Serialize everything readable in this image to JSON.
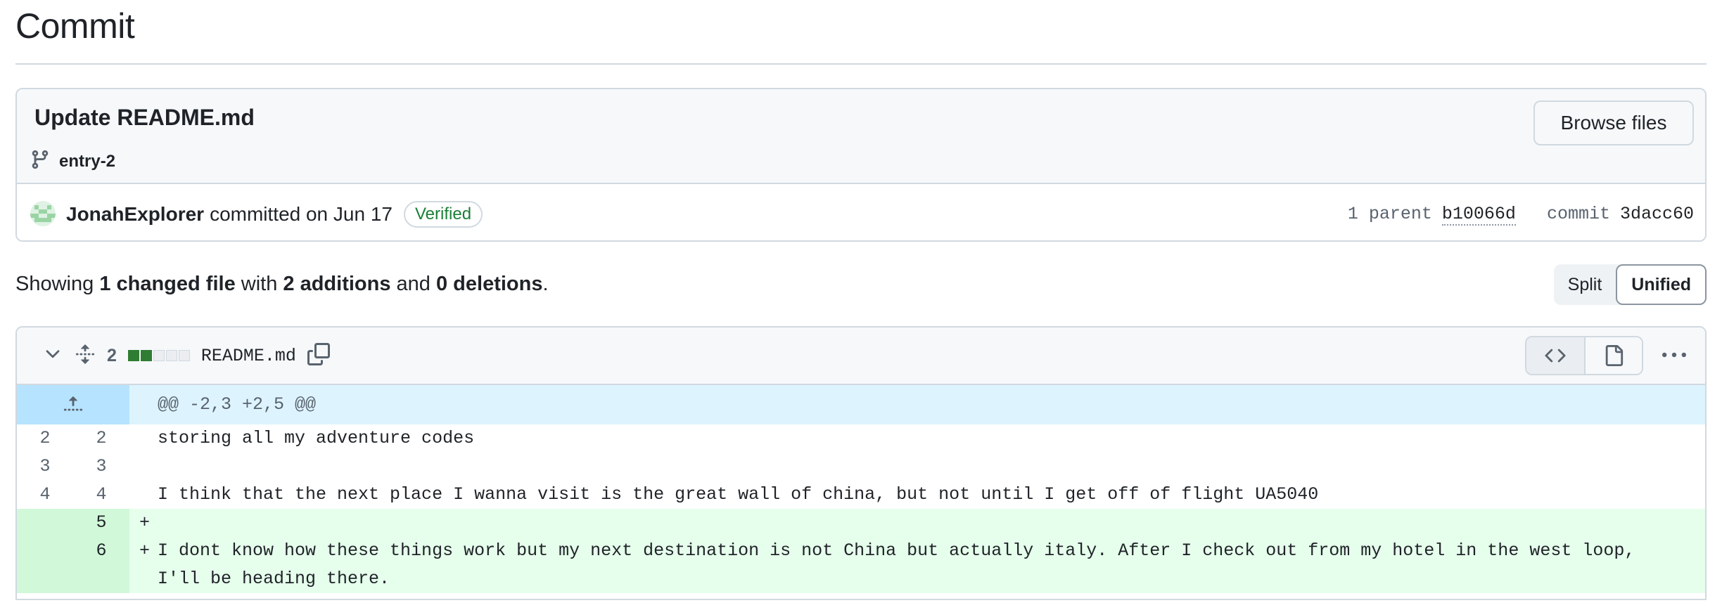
{
  "page": {
    "title": "Commit"
  },
  "commit": {
    "message": "Update README.md",
    "branch": "entry-2",
    "browse_label": "Browse files",
    "author": "JonahExplorer",
    "committed_text": "committed on Jun 17",
    "verified_label": "Verified",
    "parent_label": "1 parent",
    "parent_sha": "b10066d",
    "commit_label": "commit",
    "commit_sha": "3dacc60"
  },
  "summary": {
    "prefix": "Showing",
    "files": "1 changed file",
    "with": "with",
    "additions": "2 additions",
    "and": "and",
    "deletions": "0 deletions",
    "period": "."
  },
  "view_toggle": {
    "split": "Split",
    "unified": "Unified",
    "active": "unified"
  },
  "file": {
    "change_count": "2",
    "diffstat": [
      "add",
      "add",
      "neutral",
      "neutral",
      "neutral"
    ],
    "name": "README.md",
    "hunk_header": "@@ -2,3 +2,5 @@",
    "lines": [
      {
        "type": "context",
        "old": "2",
        "new": "2",
        "text": "storing all my adventure codes"
      },
      {
        "type": "context",
        "old": "3",
        "new": "3",
        "text": ""
      },
      {
        "type": "context",
        "old": "4",
        "new": "4",
        "text": "I think that the next place I wanna visit is the great wall of china, but not until I get off of flight UA5040"
      },
      {
        "type": "add",
        "old": "",
        "new": "5",
        "marker": "+",
        "text": ""
      },
      {
        "type": "add",
        "old": "",
        "new": "6",
        "marker": "+",
        "text": "I dont know how these things work but my next destination is not China but actually italy. After I check out from my hotel in the west loop, I'll be heading there."
      }
    ]
  },
  "colors": {
    "add_bg": "#e6ffec",
    "add_gutter": "#d1f8d9",
    "hunk_bg": "#ddf4ff",
    "hunk_gutter": "#b6e3ff",
    "verified": "#1a7f37",
    "diffstat_add": "#2f7d32",
    "diffstat_neutral": "#d1d9e0"
  },
  "icons": [
    "git-branch-icon",
    "avatar",
    "chevron-down-icon",
    "unfold-icon",
    "copy-icon",
    "code-icon",
    "file-icon",
    "kebab-horizontal-icon",
    "expand-up-icon"
  ]
}
